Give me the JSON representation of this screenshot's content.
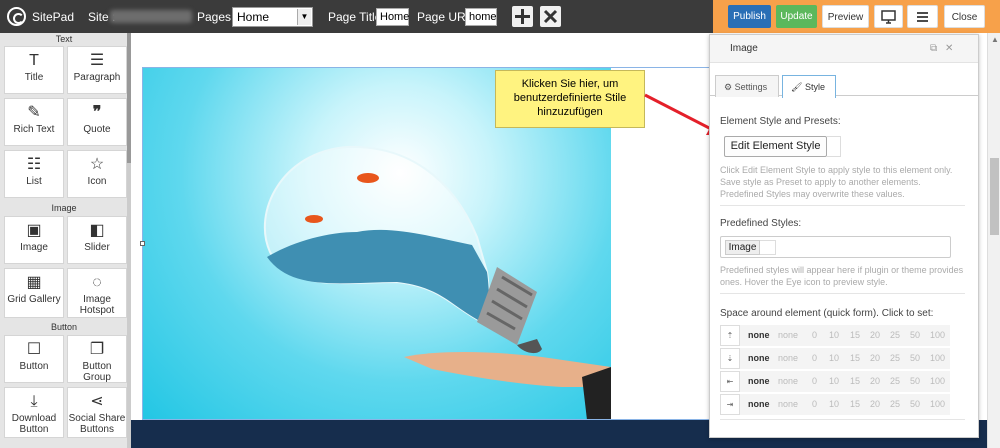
{
  "topbar": {
    "logo_text": "SitePad",
    "site_label": "Site :",
    "pages_label": "Pages :",
    "pages_value": "Home",
    "page_title_label": "Page Title:",
    "page_title_value": "Home",
    "page_url_label": "Page URL:",
    "page_url_value": "home",
    "add_icon": "plus-icon",
    "close_page_icon": "x-icon",
    "publish": "Publish",
    "update": "Update",
    "preview": "Preview",
    "desktop_icon": "monitor-icon",
    "menu_icon": "hamburger-icon",
    "close": "Close",
    "accent_color": "#f7a14a",
    "publish_color": "#2a6fb6",
    "update_color": "#5cb85c"
  },
  "sidebar": {
    "section_text": "Text",
    "section_image": "Image",
    "section_button": "Button",
    "widgets": {
      "title": "Title",
      "paragraph": "Paragraph",
      "rich_text": "Rich Text",
      "quote": "Quote",
      "list": "List",
      "icon": "Icon",
      "image": "Image",
      "slider": "Slider",
      "grid_gallery": "Grid Gallery",
      "image_hotspot": "Image Hotspot",
      "button": "Button",
      "button_group": "Button Group",
      "download_button": "Download Button",
      "social_share_buttons": "Social Share Buttons"
    }
  },
  "callout": {
    "text": "Klicken Sie hier, um benutzerdefinierte Stile hinzuzufügen"
  },
  "panel": {
    "title": "Image",
    "tab_settings": "Settings",
    "tab_style": "Style",
    "element_style_label": "Element Style and Presets:",
    "edit_button": "Edit Element Style",
    "edit_hint": "Click Edit Element Style to apply style to this element only. Save style as Preset to apply to another elements. Predefined Styles may overwrite these values.",
    "predefined_label": "Predefined Styles:",
    "preset_chip": "Image",
    "predefined_hint": "Predefined styles will appear here if plugin or theme provides ones. Hover the Eye icon to preview style.",
    "space_label": "Space around element (quick form). Click to set:",
    "space_rows": [
      {
        "icon": "arrow-top-icon",
        "glyph": "⇡",
        "current": "none"
      },
      {
        "icon": "arrow-bottom-icon",
        "glyph": "⇣",
        "current": "none"
      },
      {
        "icon": "arrow-left-icon",
        "glyph": "⇤",
        "current": "none"
      },
      {
        "icon": "arrow-right-icon",
        "glyph": "⇥",
        "current": "none"
      }
    ],
    "space_options": [
      "none",
      "0",
      "10",
      "15",
      "20",
      "25",
      "50",
      "100"
    ]
  }
}
